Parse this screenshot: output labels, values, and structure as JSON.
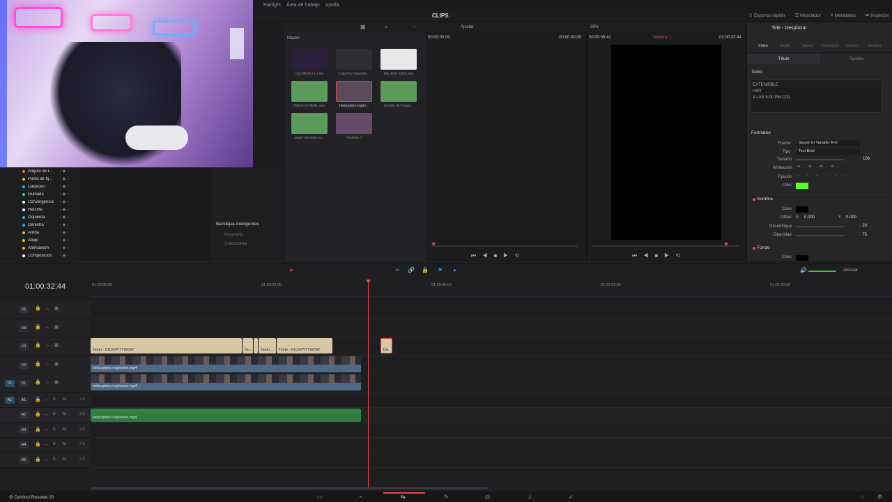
{
  "menu": {
    "items": [
      "Fairlight",
      "Área de trabajo",
      "Ayuda"
    ]
  },
  "header": {
    "center_title": "CLIPS",
    "right_buttons": [
      {
        "label": "Exportar rápido",
        "icon": "export-icon"
      },
      {
        "label": "Mezclador",
        "icon": "mixer-icon"
      },
      {
        "label": "Metadatos",
        "icon": "metadata-icon"
      },
      {
        "label": "Inspector",
        "icon": "inspector-icon",
        "active": true
      }
    ]
  },
  "media_pool": {
    "bin_label": "Master",
    "clips": [
      {
        "label": "clip MIEDO 1.mov",
        "color": "#2a1f3d"
      },
      {
        "label": "Cute Pop Sound E...",
        "color": "#2e2e30"
      },
      {
        "label": "ENLACE KICK.png",
        "color": "#e8e8e8"
      },
      {
        "label": "HAGALO REAL.wav",
        "color": "#5a9a5a"
      },
      {
        "label": "helicoptero explo...",
        "color": "#5a4a5a",
        "selected": true
      },
      {
        "label": "Sonido de Fuego...",
        "color": "#5a9a5a"
      },
      {
        "label": "super windows er...",
        "color": "#5a9a5a"
      },
      {
        "label": "Timeline 1",
        "color": "#6a4a6a"
      }
    ],
    "smart_bins": {
      "title": "Bandejas inteligentes",
      "items": [
        "Keywords",
        "Colecciones"
      ]
    }
  },
  "source_viewer": {
    "zoom": "Ajustar",
    "timecode_left": "00:00:00:00",
    "timecode_right": "00:00:00:00"
  },
  "timeline_viewer": {
    "zoom": "29%",
    "timecode_left": "00:00:35:41",
    "timeline_name": "Timeline 1",
    "timecode_right": "01:00:32:44"
  },
  "inspector": {
    "title": "Title - Desplazar",
    "tabs": [
      "Video",
      "Audio",
      "Efecto",
      "Transición",
      "Imagen",
      "Archivo"
    ],
    "subtabs": [
      "Título",
      "Ajustes"
    ],
    "texto_section": "Texto",
    "text_lines": [
      "EXTENSIBLE",
      "HOY",
      "A LAS 5:00 PM COL"
    ],
    "formato_section": "Formateo",
    "fuente_label": "Fuente",
    "fuente_value": "Segoe UI Variable Text",
    "tipo_label": "Tipo",
    "tipo_value": "Text Bold",
    "tamano_label": "Tamaño",
    "tamano_value": "108",
    "alineacion_label": "Alineación",
    "fijacion_label": "Fijación",
    "color_label": "Color",
    "text_color": "#5cff2e",
    "sombra_section": "Sombra",
    "sombra_color_label": "Color",
    "offset_label": "Offset",
    "offset_x_label": "X",
    "offset_x": "0.000",
    "offset_y_label": "Y",
    "offset_y": "0.000",
    "desenfoque_label": "Desenfoque",
    "desenfoque_value": "20",
    "opacidad_label": "Opacidad",
    "opacidad_value": "75",
    "fondo_section": "Fondo",
    "fondo_color_label": "Color"
  },
  "effects_list": [
    {
      "label": "Ángulo de r...",
      "color": "#e07a2a"
    },
    {
      "label": "Punto de fij...",
      "color": "#e0c02a"
    },
    {
      "label": "Cabeceo",
      "color": "#2ab0e0"
    },
    {
      "label": "Guiñada",
      "color": "#2ae07a"
    },
    {
      "label": "Convergencia",
      "color": "#ffffff"
    },
    {
      "label": "Recorte",
      "color": "#ffffff"
    },
    {
      "label": "Izquierda",
      "color": "#2ab0e0"
    },
    {
      "label": "Derecha",
      "color": "#2ab0e0"
    },
    {
      "label": "Arriba",
      "color": "#e0c02a"
    },
    {
      "label": "Abajo",
      "color": "#e0c02a"
    },
    {
      "label": "Atenuación",
      "color": "#e0c02a"
    },
    {
      "label": "Composición",
      "color": "#ffffff"
    }
  ],
  "timeline": {
    "timecode": "01:00:32:44",
    "ruler_labels": [
      "01:00:00:00",
      "01:00:20:00",
      "01:00:40:00",
      "01:01:00:00",
      "01:01:20:00"
    ],
    "video_tracks": [
      "V5",
      "V4",
      "V3",
      "V2",
      "V1"
    ],
    "source_video": "V1",
    "audio_tracks": [
      "A1",
      "A2",
      "A3",
      "A4",
      "A5"
    ],
    "source_audio": "A1",
    "audio_level": "2.0",
    "audio_solo": "S",
    "audio_mute": "M",
    "v3_clips": [
      "Texto - KICK/PITTWOW",
      "Te...",
      "Texto ...",
      "Texto - KICK/PITTWOW"
    ],
    "v3_small_clip": "De...",
    "v2_clip": "helicoptero explosive.mp4",
    "v1_clip": "helicoptero explosive.mp4",
    "a2_clip": "helicoptero explosive.mp4",
    "attenuate_label": "Atenuar"
  },
  "bottom": {
    "app_name": "DaVinci Resolve 20"
  }
}
